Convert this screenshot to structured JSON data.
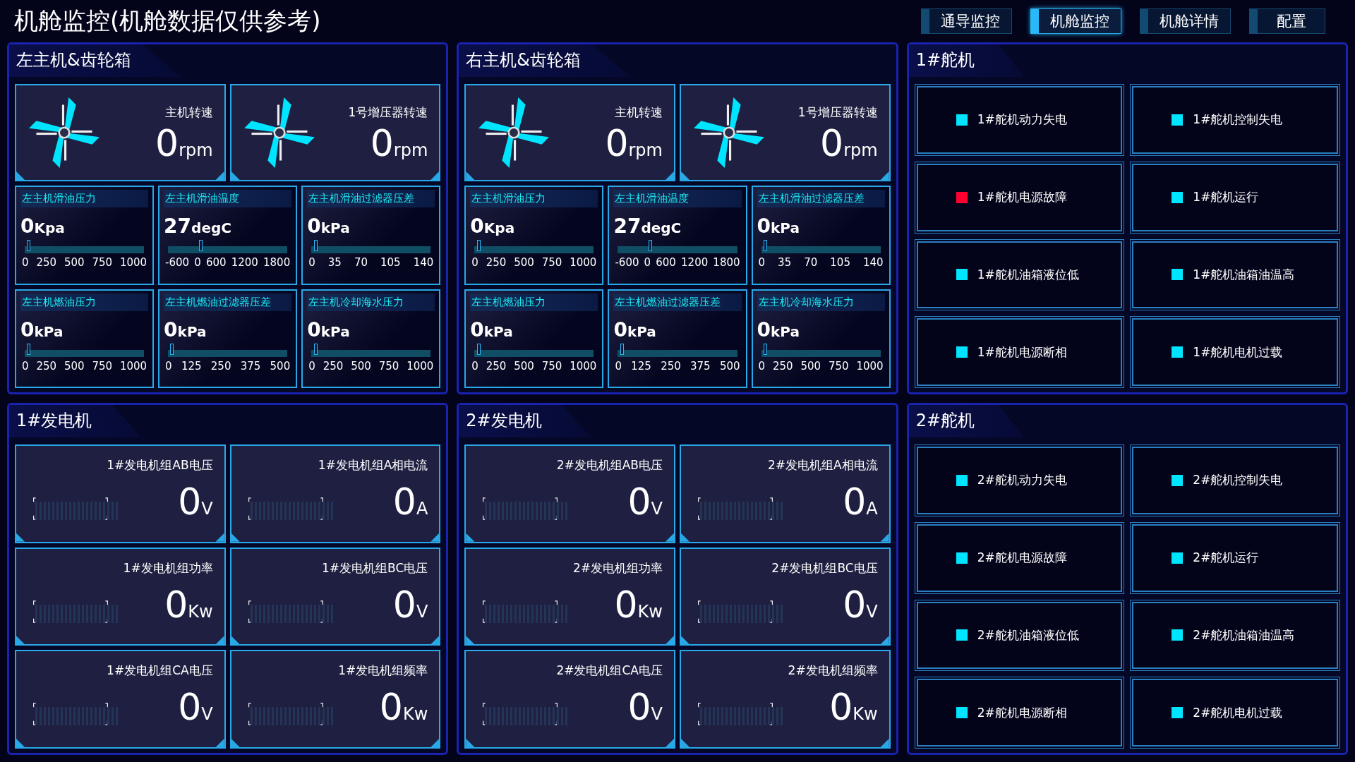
{
  "title": "机舱监控(机舱数据仅供参考)",
  "nav_tabs": [
    {
      "label": "通导监控",
      "selected": false
    },
    {
      "label": "机舱监控",
      "selected": true
    },
    {
      "label": "机舱详情",
      "selected": false
    },
    {
      "label": "配置",
      "selected": false
    }
  ],
  "engines": [
    {
      "title": "左主机&齿轮箱",
      "speeds": [
        {
          "label": "主机转速",
          "value": "0",
          "unit": "rpm"
        },
        {
          "label": "1号增压器转速",
          "value": "0",
          "unit": "rpm"
        }
      ],
      "gauges": [
        {
          "label": "左主机滑油压力",
          "value": "0",
          "unit": "Kpa",
          "level": 0.02,
          "ticks": [
            "0",
            "250",
            "500",
            "750",
            "1000"
          ]
        },
        {
          "label": "左主机滑油温度",
          "value": "27",
          "unit": "degC",
          "level": 0.26,
          "ticks": [
            "-600",
            "0",
            "600",
            "1200",
            "1800"
          ]
        },
        {
          "label": "左主机滑油过滤器压差",
          "value": "0",
          "unit": "kPa",
          "level": 0.02,
          "ticks": [
            "0",
            "35",
            "70",
            "105",
            "140"
          ]
        },
        {
          "label": "左主机燃油压力",
          "value": "0",
          "unit": "kPa",
          "level": 0.02,
          "ticks": [
            "0",
            "250",
            "500",
            "750",
            "1000"
          ]
        },
        {
          "label": "左主机燃油过滤器压差",
          "value": "0",
          "unit": "kPa",
          "level": 0.02,
          "ticks": [
            "0",
            "125",
            "250",
            "375",
            "500"
          ]
        },
        {
          "label": "左主机冷却海水压力",
          "value": "0",
          "unit": "kPa",
          "level": 0.02,
          "ticks": [
            "0",
            "250",
            "500",
            "750",
            "1000"
          ]
        }
      ]
    },
    {
      "title": "右主机&齿轮箱",
      "speeds": [
        {
          "label": "主机转速",
          "value": "0",
          "unit": "rpm"
        },
        {
          "label": "1号增压器转速",
          "value": "0",
          "unit": "rpm"
        }
      ],
      "gauges": [
        {
          "label": "左主机滑油压力",
          "value": "0",
          "unit": "Kpa",
          "level": 0.02,
          "ticks": [
            "0",
            "250",
            "500",
            "750",
            "1000"
          ]
        },
        {
          "label": "左主机滑油温度",
          "value": "27",
          "unit": "degC",
          "level": 0.26,
          "ticks": [
            "-600",
            "0",
            "600",
            "1200",
            "1800"
          ]
        },
        {
          "label": "左主机滑油过滤器压差",
          "value": "0",
          "unit": "kPa",
          "level": 0.02,
          "ticks": [
            "0",
            "35",
            "70",
            "105",
            "140"
          ]
        },
        {
          "label": "左主机燃油压力",
          "value": "0",
          "unit": "kPa",
          "level": 0.02,
          "ticks": [
            "0",
            "250",
            "500",
            "750",
            "1000"
          ]
        },
        {
          "label": "左主机燃油过滤器压差",
          "value": "0",
          "unit": "kPa",
          "level": 0.02,
          "ticks": [
            "0",
            "125",
            "250",
            "375",
            "500"
          ]
        },
        {
          "label": "左主机冷却海水压力",
          "value": "0",
          "unit": "kPa",
          "level": 0.02,
          "ticks": [
            "0",
            "250",
            "500",
            "750",
            "1000"
          ]
        }
      ]
    }
  ],
  "generators": [
    {
      "title": "1#发电机",
      "meters": [
        {
          "label": "1#发电机组AB电压",
          "value": "0",
          "unit": "V"
        },
        {
          "label": "1#发电机组A相电流",
          "value": "0",
          "unit": "A"
        },
        {
          "label": "1#发电机组功率",
          "value": "0",
          "unit": "Kw"
        },
        {
          "label": "1#发电机组BC电压",
          "value": "0",
          "unit": "V"
        },
        {
          "label": "1#发电机组CA电压",
          "value": "0",
          "unit": "V"
        },
        {
          "label": "1#发电机组频率",
          "value": "0",
          "unit": "Kw"
        }
      ]
    },
    {
      "title": "2#发电机",
      "meters": [
        {
          "label": "2#发电机组AB电压",
          "value": "0",
          "unit": "V"
        },
        {
          "label": "2#发电机组A相电流",
          "value": "0",
          "unit": "A"
        },
        {
          "label": "2#发电机组功率",
          "value": "0",
          "unit": "Kw"
        },
        {
          "label": "2#发电机组BC电压",
          "value": "0",
          "unit": "V"
        },
        {
          "label": "2#发电机组CA电压",
          "value": "0",
          "unit": "V"
        },
        {
          "label": "2#发电机组频率",
          "value": "0",
          "unit": "Kw"
        }
      ]
    }
  ],
  "steering": [
    {
      "title": "1#舵机",
      "alarms": [
        {
          "label": "1#舵机动力失电",
          "color": "#00e5ff"
        },
        {
          "label": "1#舵机控制失电",
          "color": "#00e5ff"
        },
        {
          "label": "1#舵机电源故障",
          "color": "#ff0030"
        },
        {
          "label": "1#舵机运行",
          "color": "#00e5ff"
        },
        {
          "label": "1#舵机油箱液位低",
          "color": "#00e5ff"
        },
        {
          "label": "1#舵机油箱油温高",
          "color": "#00e5ff"
        },
        {
          "label": "1#舵机电源断相",
          "color": "#00e5ff"
        },
        {
          "label": "1#舵机电机过载",
          "color": "#00e5ff"
        }
      ]
    },
    {
      "title": "2#舵机",
      "alarms": [
        {
          "label": "2#舵机动力失电",
          "color": "#00e5ff"
        },
        {
          "label": "2#舵机控制失电",
          "color": "#00e5ff"
        },
        {
          "label": "2#舵机电源故障",
          "color": "#00e5ff"
        },
        {
          "label": "2#舵机运行",
          "color": "#00e5ff"
        },
        {
          "label": "2#舵机油箱液位低",
          "color": "#00e5ff"
        },
        {
          "label": "2#舵机油箱油温高",
          "color": "#00e5ff"
        },
        {
          "label": "2#舵机电源断相",
          "color": "#00e5ff"
        },
        {
          "label": "2#舵机电机过载",
          "color": "#00e5ff"
        }
      ]
    }
  ]
}
